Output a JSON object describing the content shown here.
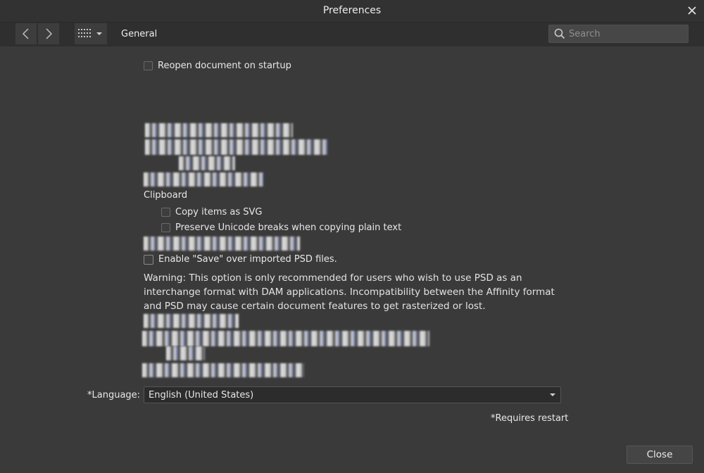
{
  "window": {
    "title": "Preferences"
  },
  "toolbar": {
    "section_title": "General",
    "search_placeholder": "Search"
  },
  "general": {
    "reopen_label": "Reopen document on startup",
    "reopen_checked": false
  },
  "clipboard": {
    "heading": "Clipboard",
    "copy_svg_label": "Copy items as SVG",
    "copy_svg_checked": false,
    "preserve_unicode_label": "Preserve Unicode breaks when copying plain text",
    "preserve_unicode_checked": false
  },
  "psd": {
    "enable_save_label": "Enable \"Save\" over imported PSD files.",
    "enable_save_checked": false,
    "warning": "Warning: This option is only recommended for users who wish to use PSD as an interchange format with DAM applications. Incompatibility between the Affinity format and PSD may cause certain document features to get rasterized or lost."
  },
  "language": {
    "label": "*Language:",
    "selected": "English (United States)"
  },
  "footer": {
    "restart_note": "*Requires restart",
    "close_label": "Close"
  }
}
